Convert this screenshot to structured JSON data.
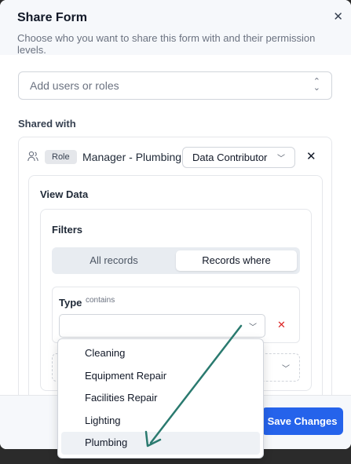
{
  "dialog": {
    "title": "Share Form",
    "subtitle": "Choose who you want to share this form with and their permission levels.",
    "close_icon": "close-icon"
  },
  "add_users": {
    "placeholder": "Add users or roles"
  },
  "shared_with": {
    "label": "Shared with",
    "entry": {
      "type_badge": "Role",
      "name": "Manager - Plumbing",
      "permission": "Data Contributor"
    }
  },
  "view_data": {
    "title": "View Data",
    "filters": {
      "title": "Filters",
      "tabs": [
        "All records",
        "Records where"
      ],
      "selected_tab": "Records where",
      "condition": {
        "field": "Type",
        "operator": "contains",
        "value": ""
      }
    }
  },
  "dropdown": {
    "options": [
      "Cleaning",
      "Equipment Repair",
      "Facilities Repair",
      "Lighting",
      "Plumbing"
    ],
    "highlighted": "Plumbing"
  },
  "footer": {
    "save_label": "Save Changes"
  },
  "colors": {
    "accent": "#2563eb",
    "annotation_arrow": "#2a7a6f",
    "danger": "#dc2626"
  }
}
